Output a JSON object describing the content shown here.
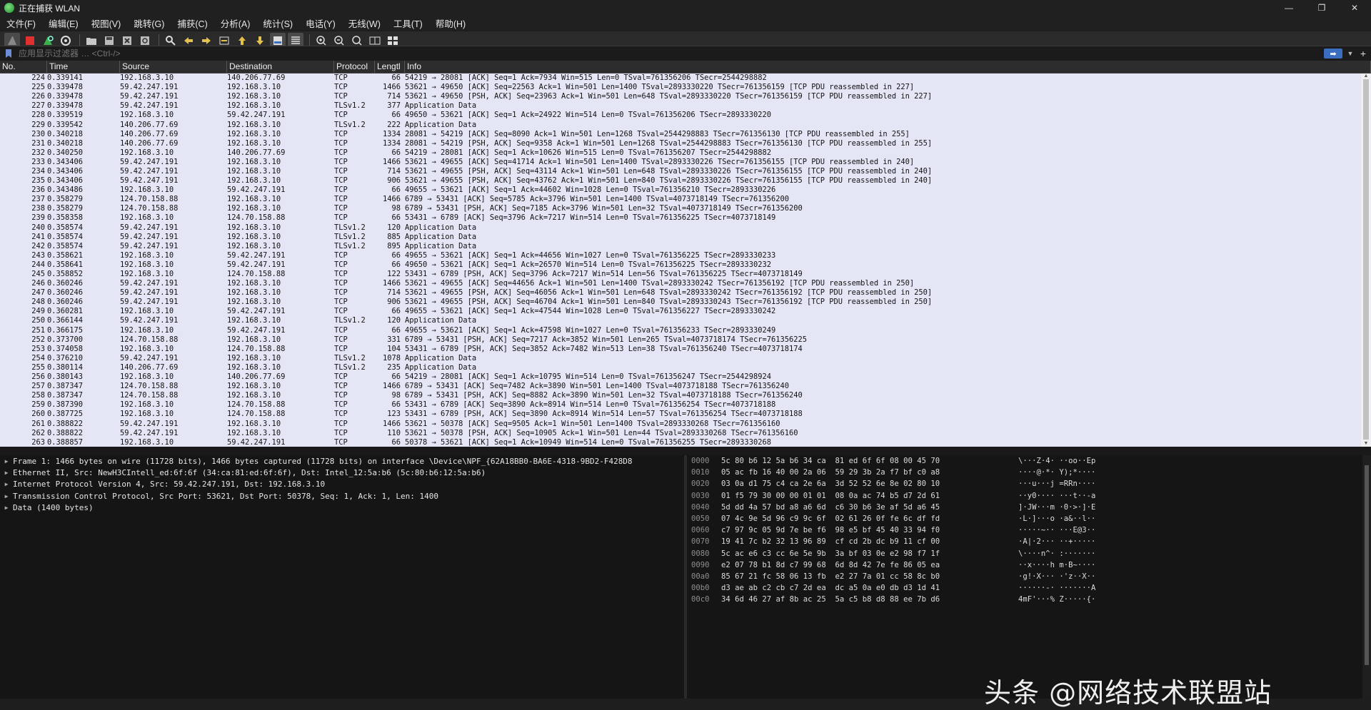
{
  "window": {
    "title": "正在捕获 WLAN",
    "minimize": "—",
    "restore": "❐",
    "close": "✕"
  },
  "menu": [
    "文件(F)",
    "编辑(E)",
    "视图(V)",
    "跳转(G)",
    "捕获(C)",
    "分析(A)",
    "统计(S)",
    "电话(Y)",
    "无线(W)",
    "工具(T)",
    "帮助(H)"
  ],
  "filter": {
    "placeholder": "应用显示过滤器 … <Ctrl-/>",
    "apply_arrow": "➡",
    "dropdown": "▼",
    "add": "+"
  },
  "columns": {
    "no": "No.",
    "time": "Time",
    "source": "Source",
    "destination": "Destination",
    "protocol": "Protocol",
    "length": "Lengtl",
    "info": "Info"
  },
  "packets": [
    [
      "224",
      "0.339141",
      "192.168.3.10",
      "140.206.77.69",
      "TCP",
      "66",
      "54219 → 28081 [ACK] Seq=1 Ack=7934 Win=515 Len=0 TSval=761356206 TSecr=2544298882"
    ],
    [
      "225",
      "0.339478",
      "59.42.247.191",
      "192.168.3.10",
      "TCP",
      "1466",
      "53621 → 49650 [ACK] Seq=22563 Ack=1 Win=501 Len=1400 TSval=2893330220 TSecr=761356159 [TCP PDU reassembled in 227]"
    ],
    [
      "226",
      "0.339478",
      "59.42.247.191",
      "192.168.3.10",
      "TCP",
      "714",
      "53621 → 49650 [PSH, ACK] Seq=23963 Ack=1 Win=501 Len=648 TSval=2893330220 TSecr=761356159 [TCP PDU reassembled in 227]"
    ],
    [
      "227",
      "0.339478",
      "59.42.247.191",
      "192.168.3.10",
      "TLSv1.2",
      "377",
      "Application Data"
    ],
    [
      "228",
      "0.339519",
      "192.168.3.10",
      "59.42.247.191",
      "TCP",
      "66",
      "49650 → 53621 [ACK] Seq=1 Ack=24922 Win=514 Len=0 TSval=761356206 TSecr=2893330220"
    ],
    [
      "229",
      "0.339542",
      "140.206.77.69",
      "192.168.3.10",
      "TLSv1.2",
      "222",
      "Application Data"
    ],
    [
      "230",
      "0.340218",
      "140.206.77.69",
      "192.168.3.10",
      "TCP",
      "1334",
      "28081 → 54219 [ACK] Seq=8090 Ack=1 Win=501 Len=1268 TSval=2544298883 TSecr=761356130 [TCP PDU reassembled in 255]"
    ],
    [
      "231",
      "0.340218",
      "140.206.77.69",
      "192.168.3.10",
      "TCP",
      "1334",
      "28081 → 54219 [PSH, ACK] Seq=9358 Ack=1 Win=501 Len=1268 TSval=2544298883 TSecr=761356130 [TCP PDU reassembled in 255]"
    ],
    [
      "232",
      "0.340250",
      "192.168.3.10",
      "140.206.77.69",
      "TCP",
      "66",
      "54219 → 28081 [ACK] Seq=1 Ack=10626 Win=515 Len=0 TSval=761356207 TSecr=2544298882"
    ],
    [
      "233",
      "0.343406",
      "59.42.247.191",
      "192.168.3.10",
      "TCP",
      "1466",
      "53621 → 49655 [ACK] Seq=41714 Ack=1 Win=501 Len=1400 TSval=2893330226 TSecr=761356155 [TCP PDU reassembled in 240]"
    ],
    [
      "234",
      "0.343406",
      "59.42.247.191",
      "192.168.3.10",
      "TCP",
      "714",
      "53621 → 49655 [PSH, ACK] Seq=43114 Ack=1 Win=501 Len=648 TSval=2893330226 TSecr=761356155 [TCP PDU reassembled in 240]"
    ],
    [
      "235",
      "0.343406",
      "59.42.247.191",
      "192.168.3.10",
      "TCP",
      "906",
      "53621 → 49655 [PSH, ACK] Seq=43762 Ack=1 Win=501 Len=840 TSval=2893330226 TSecr=761356155 [TCP PDU reassembled in 240]"
    ],
    [
      "236",
      "0.343486",
      "192.168.3.10",
      "59.42.247.191",
      "TCP",
      "66",
      "49655 → 53621 [ACK] Seq=1 Ack=44602 Win=1028 Len=0 TSval=761356210 TSecr=2893330226"
    ],
    [
      "237",
      "0.358279",
      "124.70.158.88",
      "192.168.3.10",
      "TCP",
      "1466",
      "6789 → 53431 [ACK] Seq=5785 Ack=3796 Win=501 Len=1400 TSval=4073718149 TSecr=761356200"
    ],
    [
      "238",
      "0.358279",
      "124.70.158.88",
      "192.168.3.10",
      "TCP",
      "98",
      "6789 → 53431 [PSH, ACK] Seq=7185 Ack=3796 Win=501 Len=32 TSval=4073718149 TSecr=761356200"
    ],
    [
      "239",
      "0.358358",
      "192.168.3.10",
      "124.70.158.88",
      "TCP",
      "66",
      "53431 → 6789 [ACK] Seq=3796 Ack=7217 Win=514 Len=0 TSval=761356225 TSecr=4073718149"
    ],
    [
      "240",
      "0.358574",
      "59.42.247.191",
      "192.168.3.10",
      "TLSv1.2",
      "120",
      "Application Data"
    ],
    [
      "241",
      "0.358574",
      "59.42.247.191",
      "192.168.3.10",
      "TLSv1.2",
      "885",
      "Application Data"
    ],
    [
      "242",
      "0.358574",
      "59.42.247.191",
      "192.168.3.10",
      "TLSv1.2",
      "895",
      "Application Data"
    ],
    [
      "243",
      "0.358621",
      "192.168.3.10",
      "59.42.247.191",
      "TCP",
      "66",
      "49655 → 53621 [ACK] Seq=1 Ack=44656 Win=1027 Len=0 TSval=761356225 TSecr=2893330233"
    ],
    [
      "244",
      "0.358641",
      "192.168.3.10",
      "59.42.247.191",
      "TCP",
      "66",
      "49650 → 53621 [ACK] Seq=1 Ack=26570 Win=514 Len=0 TSval=761356225 TSecr=2893330232"
    ],
    [
      "245",
      "0.358852",
      "192.168.3.10",
      "124.70.158.88",
      "TCP",
      "122",
      "53431 → 6789 [PSH, ACK] Seq=3796 Ack=7217 Win=514 Len=56 TSval=761356225 TSecr=4073718149"
    ],
    [
      "246",
      "0.360246",
      "59.42.247.191",
      "192.168.3.10",
      "TCP",
      "1466",
      "53621 → 49655 [ACK] Seq=44656 Ack=1 Win=501 Len=1400 TSval=2893330242 TSecr=761356192 [TCP PDU reassembled in 250]"
    ],
    [
      "247",
      "0.360246",
      "59.42.247.191",
      "192.168.3.10",
      "TCP",
      "714",
      "53621 → 49655 [PSH, ACK] Seq=46056 Ack=1 Win=501 Len=648 TSval=2893330242 TSecr=761356192 [TCP PDU reassembled in 250]"
    ],
    [
      "248",
      "0.360246",
      "59.42.247.191",
      "192.168.3.10",
      "TCP",
      "906",
      "53621 → 49655 [PSH, ACK] Seq=46704 Ack=1 Win=501 Len=840 TSval=2893330243 TSecr=761356192 [TCP PDU reassembled in 250]"
    ],
    [
      "249",
      "0.360281",
      "192.168.3.10",
      "59.42.247.191",
      "TCP",
      "66",
      "49655 → 53621 [ACK] Seq=1 Ack=47544 Win=1028 Len=0 TSval=761356227 TSecr=2893330242"
    ],
    [
      "250",
      "0.366144",
      "59.42.247.191",
      "192.168.3.10",
      "TLSv1.2",
      "120",
      "Application Data"
    ],
    [
      "251",
      "0.366175",
      "192.168.3.10",
      "59.42.247.191",
      "TCP",
      "66",
      "49655 → 53621 [ACK] Seq=1 Ack=47598 Win=1027 Len=0 TSval=761356233 TSecr=2893330249"
    ],
    [
      "252",
      "0.373700",
      "124.70.158.88",
      "192.168.3.10",
      "TCP",
      "331",
      "6789 → 53431 [PSH, ACK] Seq=7217 Ack=3852 Win=501 Len=265 TSval=4073718174 TSecr=761356225"
    ],
    [
      "253",
      "0.374058",
      "192.168.3.10",
      "124.70.158.88",
      "TCP",
      "104",
      "53431 → 6789 [PSH, ACK] Seq=3852 Ack=7482 Win=513 Len=38 TSval=761356240 TSecr=4073718174"
    ],
    [
      "254",
      "0.376210",
      "59.42.247.191",
      "192.168.3.10",
      "TLSv1.2",
      "1078",
      "Application Data"
    ],
    [
      "255",
      "0.380114",
      "140.206.77.69",
      "192.168.3.10",
      "TLSv1.2",
      "235",
      "Application Data"
    ],
    [
      "256",
      "0.380143",
      "192.168.3.10",
      "140.206.77.69",
      "TCP",
      "66",
      "54219 → 28081 [ACK] Seq=1 Ack=10795 Win=514 Len=0 TSval=761356247 TSecr=2544298924"
    ],
    [
      "257",
      "0.387347",
      "124.70.158.88",
      "192.168.3.10",
      "TCP",
      "1466",
      "6789 → 53431 [ACK] Seq=7482 Ack=3890 Win=501 Len=1400 TSval=4073718188 TSecr=761356240"
    ],
    [
      "258",
      "0.387347",
      "124.70.158.88",
      "192.168.3.10",
      "TCP",
      "98",
      "6789 → 53431 [PSH, ACK] Seq=8882 Ack=3890 Win=501 Len=32 TSval=4073718188 TSecr=761356240"
    ],
    [
      "259",
      "0.387390",
      "192.168.3.10",
      "124.70.158.88",
      "TCP",
      "66",
      "53431 → 6789 [ACK] Seq=3890 Ack=8914 Win=514 Len=0 TSval=761356254 TSecr=4073718188"
    ],
    [
      "260",
      "0.387725",
      "192.168.3.10",
      "124.70.158.88",
      "TCP",
      "123",
      "53431 → 6789 [PSH, ACK] Seq=3890 Ack=8914 Win=514 Len=57 TSval=761356254 TSecr=4073718188"
    ],
    [
      "261",
      "0.388822",
      "59.42.247.191",
      "192.168.3.10",
      "TCP",
      "1466",
      "53621 → 50378 [ACK] Seq=9505 Ack=1 Win=501 Len=1400 TSval=2893330268 TSecr=761356160"
    ],
    [
      "262",
      "0.388822",
      "59.42.247.191",
      "192.168.3.10",
      "TCP",
      "110",
      "53621 → 50378 [PSH, ACK] Seq=10905 Ack=1 Win=501 Len=44 TSval=2893330268 TSecr=761356160"
    ],
    [
      "263",
      "0.388857",
      "192.168.3.10",
      "59.42.247.191",
      "TCP",
      "66",
      "50378 → 53621 [ACK] Seq=1 Ack=10949 Win=514 Len=0 TSval=761356255 TSecr=2893330268"
    ]
  ],
  "details": [
    "Frame 1: 1466 bytes on wire (11728 bits), 1466 bytes captured (11728 bits) on interface \\Device\\NPF_{62A18BB0-BA6E-4318-9BD2-F428D8",
    "Ethernet II, Src: NewH3CIntell_ed:6f:6f (34:ca:81:ed:6f:6f), Dst: Intel_12:5a:b6 (5c:80:b6:12:5a:b6)",
    "Internet Protocol Version 4, Src: 59.42.247.191, Dst: 192.168.3.10",
    "Transmission Control Protocol, Src Port: 53621, Dst Port: 50378, Seq: 1, Ack: 1, Len: 1400",
    "Data (1400 bytes)"
  ],
  "bytes": [
    [
      "0000",
      "5c 80 b6 12 5a b6 34 ca  81 ed 6f 6f 08 00 45 70",
      "\\···Z·4· ··oo··Ep"
    ],
    [
      "0010",
      "05 ac fb 16 40 00 2a 06  59 29 3b 2a f7 bf c0 a8",
      "····@·*· Y);*····"
    ],
    [
      "0020",
      "03 0a d1 75 c4 ca 2e 6a  3d 52 52 6e 8e 02 80 10",
      "···u···j =RRn····"
    ],
    [
      "0030",
      "01 f5 79 30 00 00 01 01  08 0a ac 74 b5 d7 2d 61",
      "··y0···· ···t··-a"
    ],
    [
      "0040",
      "5d dd 4a 57 bd a8 a6 6d  c6 30 b6 3e af 5d a6 45",
      "]·JW···m ·0·>·]·E"
    ],
    [
      "0050",
      "07 4c 9e 5d 96 c9 9c 6f  02 61 26 0f fe 6c df fd",
      "·L·]···o ·a&··l··"
    ],
    [
      "0060",
      "c7 97 9c 05 9d 7e be f6  98 e5 bf 45 40 33 94 f0",
      "·····~·· ···E@3··"
    ],
    [
      "0070",
      "19 41 7c b2 32 13 96 89  cf cd 2b dc b9 11 cf 00",
      "·A|·2··· ··+·····"
    ],
    [
      "0080",
      "5c ac e6 c3 cc 6e 5e 9b  3a bf 03 0e e2 98 f7 1f",
      "\\····n^· :·······"
    ],
    [
      "0090",
      "e2 07 78 b1 8d c7 99 68  6d 8d 42 7e fe 86 05 ea",
      "··x····h m·B~····"
    ],
    [
      "00a0",
      "85 67 21 fc 58 06 13 fb  e2 27 7a 01 cc 58 8c b0",
      "·g!·X··· ·'z··X··"
    ],
    [
      "00b0",
      "d3 ae ab c2 cb c7 2d ea  dc a5 0a e0 db d3 1d 41",
      "······-· ·······A"
    ],
    [
      "00c0",
      "34 6d 46 27 af 8b ac 25  5a c5 b8 d8 88 ee 7b d6",
      "4mF'···% Z·····{·"
    ]
  ],
  "watermark": "头条 @网络技术联盟站"
}
